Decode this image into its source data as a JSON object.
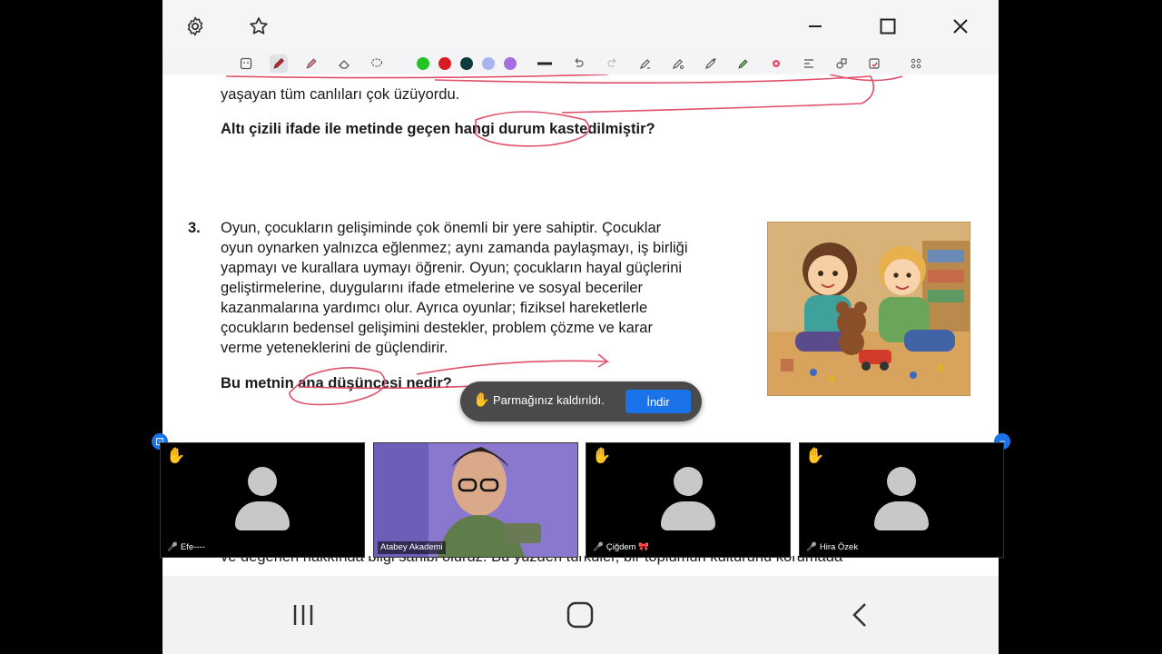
{
  "document": {
    "intro_line": "yaşayan tüm canlıları çok üzüyordu.",
    "question2": "Altı çizili ifade ile metinde geçen hangi durum kastedilmiştir?",
    "q3_number": "3.",
    "q3_lines": [
      "Oyun, çocukların gelişiminde çok önemli bir yere sahiptir. Çocuklar",
      "oyun oynarken yalnızca eğlenmez; aynı zamanda paylaşmayı, iş birliği",
      "yapmayı ve kurallara uymayı öğrenir. Oyun; çocukların hayal güçlerini",
      "geliştirmelerine, duygularını ifade etmelerine ve sosyal beceriler",
      "kazanmalarına yardımcı olur. Ayrıca oyunlar; fiziksel hareketlerle",
      "çocukların bedensel gelişimini destekler, problem çözme ve karar",
      "verme yeteneklerini de güçlendirir."
    ],
    "question3": "Bu metnin ana düşüncesi nedir?",
    "bottom_line": "ve değerleri hakkında bilgi sahibi oluruz. Bu yüzden türküler, bir toplumun kültürünü korumada"
  },
  "toast": {
    "message": "Parmağınız kaldırıldı.",
    "button": "İndir"
  },
  "participants": [
    {
      "name": "Efe----",
      "hand_raised": true,
      "muted": true
    },
    {
      "name": "Atabey Akademi",
      "hand_raised": false,
      "muted": false
    },
    {
      "name": "Çiğdem 🎀",
      "hand_raised": true,
      "muted": true
    },
    {
      "name": "Hira Özek",
      "hand_raised": true,
      "muted": true
    }
  ],
  "colors": {
    "pen_green": "#22c522",
    "pen_red": "#d81b22",
    "pen_dark": "#0b3b3b",
    "pen_lavender": "#a9b5f0",
    "pen_purple": "#a36ee0",
    "annotation_red": "#e0506a",
    "accent": "#1a73e8"
  },
  "icons": {
    "settings": "gear-icon",
    "favorite": "star-icon",
    "minimize": "minimize-icon",
    "maximize": "maximize-icon",
    "close": "close-icon"
  }
}
